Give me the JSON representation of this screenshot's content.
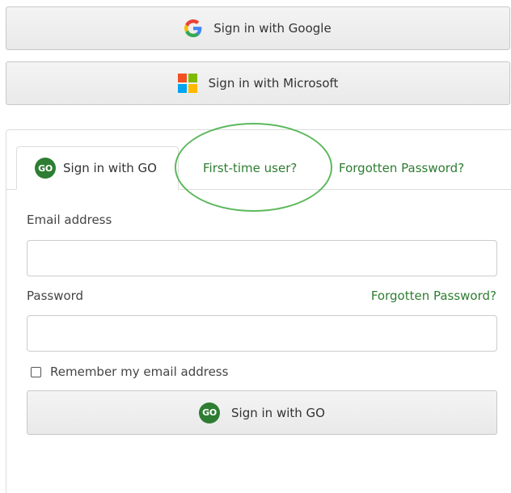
{
  "sso": {
    "google_label": "Sign in with Google",
    "google_icon": "google-g-icon",
    "microsoft_label": "Sign in with Microsoft",
    "microsoft_icon": "microsoft-logo-icon"
  },
  "tabs": [
    {
      "label": "Sign in with GO",
      "badge": "GO",
      "active": true
    },
    {
      "label": "First-time user?",
      "highlighted": true
    },
    {
      "label": "Forgotten Password?"
    }
  ],
  "form": {
    "email_label": "Email address",
    "email_value": "",
    "password_label": "Password",
    "password_value": "",
    "forgot_link": "Forgotten Password?",
    "remember_label": "Remember my email address",
    "remember_checked": false,
    "submit_label": "Sign in with GO",
    "submit_badge": "GO"
  },
  "colors": {
    "accent_green": "#2e7d32",
    "highlight_ring": "#5cb85c",
    "google_blue": "#4285F4",
    "google_red": "#EA4335",
    "google_yellow": "#FBBC05",
    "google_green": "#34A853",
    "ms_red": "#F25022",
    "ms_green": "#7FBA00",
    "ms_blue": "#00A4EF",
    "ms_yellow": "#FFB900"
  }
}
